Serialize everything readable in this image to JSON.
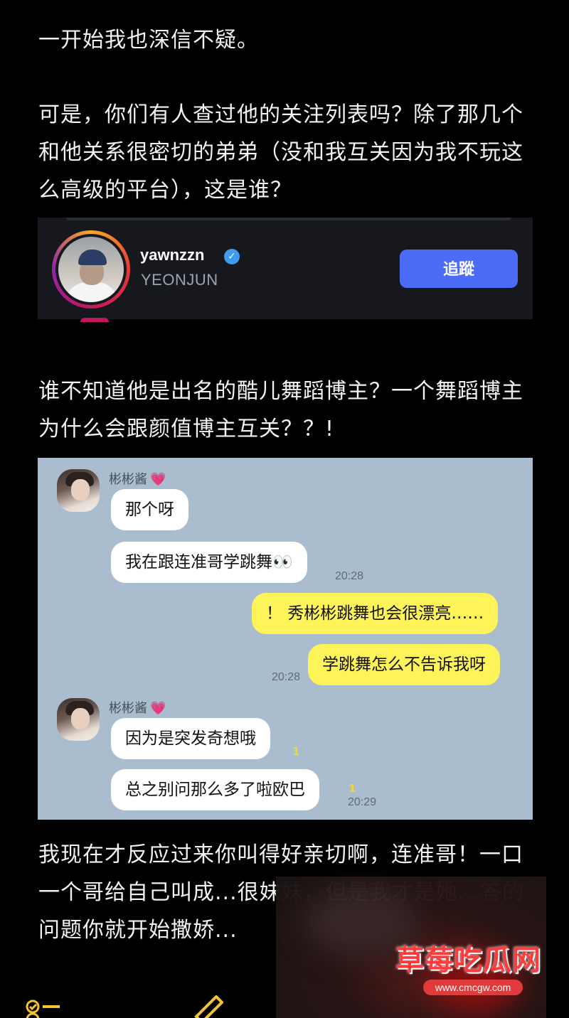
{
  "post": {
    "para1": "一开始我也深信不疑。",
    "para2": "可是，你们有人查过他的关注列表吗？除了那几个和他关系很密切的弟弟（没和我互关因为我不玩这么高级的平台），这是谁？",
    "para3": "谁不知道他是出名的酷儿舞蹈博主？一个舞蹈博主为什么会跟颜值博主互关？？!",
    "para4": "我现在才反应过来你叫得好亲切啊，连准哥！一口一个哥给自己叫成...很妹妹，但是我才是她...答的问题你就开始撒娇..."
  },
  "follow_card": {
    "username": "yawnzzn",
    "display_name": "YEONJUN",
    "follow_label": "追蹤",
    "verified_icon": "verified-badge-icon"
  },
  "chat": {
    "sender_name": "彬彬酱",
    "sender_heart": "💗",
    "messages": [
      {
        "text": "那个呀"
      },
      {
        "text": "我在跟连准哥学跳舞👀",
        "time": "20:28"
      },
      {
        "text": "！ 秀彬彬跳舞也会很漂亮……"
      },
      {
        "text": "学跳舞怎么不告诉我呀",
        "time": "20:28"
      },
      {
        "text": "因为是突发奇想哦",
        "unread": "1"
      },
      {
        "text": "总之别问那么多了啦欧巴",
        "unread": "1",
        "time": "20:29"
      }
    ],
    "colors": {
      "background": "#a9bdce",
      "incoming": "#ffffff",
      "outgoing": "#fff35a"
    }
  },
  "watermark": {
    "title": "草莓吃瓜网",
    "url": "www.cmcgw.com"
  },
  "toolbar": {
    "todo_icon": "checklist-icon",
    "pen_icon": "pen-icon"
  }
}
